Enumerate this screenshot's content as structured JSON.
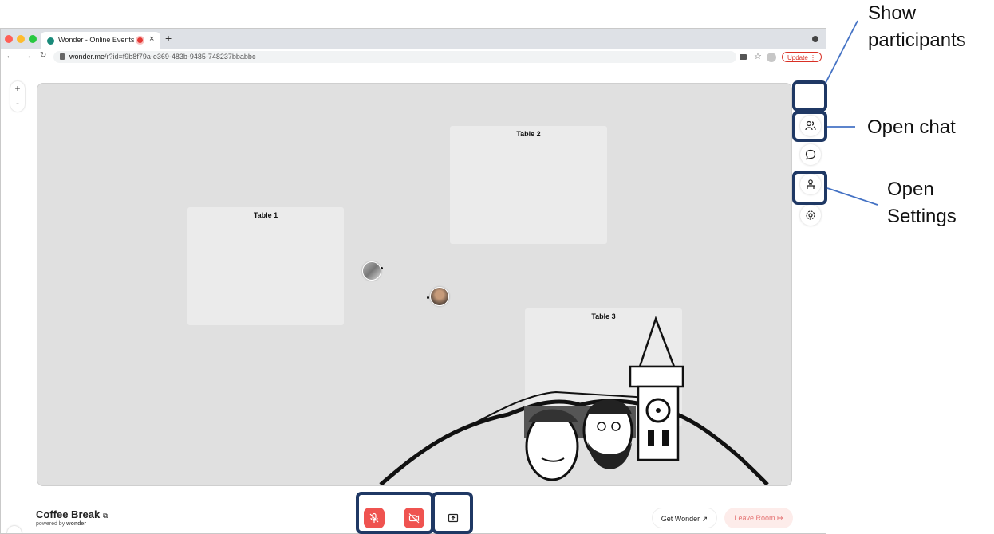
{
  "browser": {
    "tab_title": "Wonder - Online Events",
    "url_host": "wonder.me",
    "url_path": "/r?id=f9b8f79a-e369-483b-9485-748237bbabbc",
    "update_label": "Update"
  },
  "canvas": {
    "zoom_in": "+",
    "zoom_out": "-",
    "tables": [
      "Table 1",
      "Table 2",
      "Table 3"
    ]
  },
  "room": {
    "name": "Coffee Break",
    "powered_prefix": "powered by",
    "powered_brand": "wonder"
  },
  "controls": {
    "get_wonder_label": "Get Wonder",
    "leave_room_label": "Leave Room"
  },
  "annotations": {
    "participants_line1": "Show",
    "participants_line2": "participants",
    "chat": "Open chat",
    "settings_line1": "Open",
    "settings_line2": "Settings"
  },
  "colors": {
    "annotation_border": "#1f3864",
    "arrow": "#4472c4",
    "mute_red": "#ef5350",
    "leave_room_bg": "#fdecea",
    "leave_room_text": "#e57373"
  },
  "icons": [
    "participants-icon",
    "chat-icon",
    "broadcast-icon",
    "settings-icon",
    "mic-off-icon",
    "camera-off-icon",
    "screen-share-icon",
    "external-link-icon",
    "leave-icon"
  ]
}
